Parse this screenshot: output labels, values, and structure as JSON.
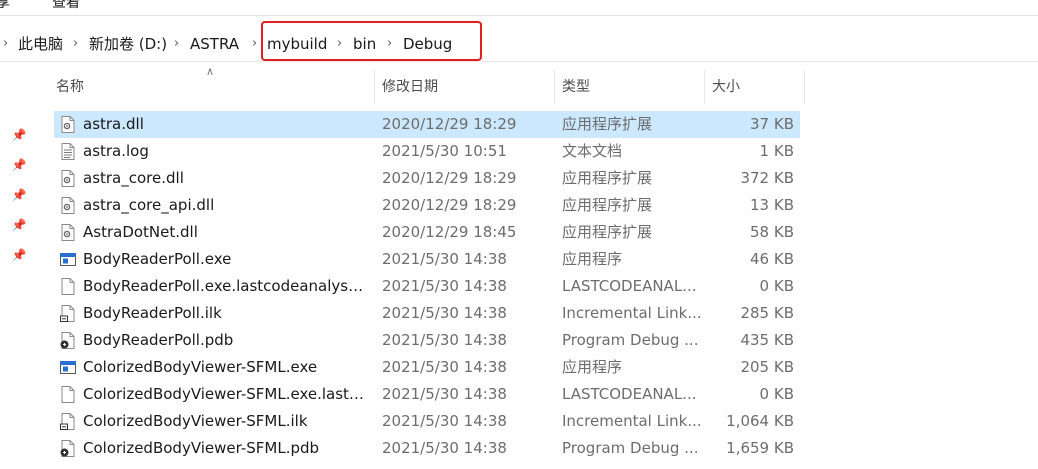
{
  "ribbon": {
    "tabs": [
      "享",
      "查看"
    ]
  },
  "breadcrumb": [
    "此电脑",
    "新加卷 (D:)",
    "ASTRA",
    "mybuild",
    "bin",
    "Debug"
  ],
  "columns": {
    "name": "名称",
    "modified": "修改日期",
    "type": "类型",
    "size": "大小"
  },
  "files": [
    {
      "name": "astra.dll",
      "modified": "2020/12/29 18:29",
      "type": "应用程序扩展",
      "size": "37 KB",
      "icon": "dll-file-icon",
      "selected": true
    },
    {
      "name": "astra.log",
      "modified": "2021/5/30 10:51",
      "type": "文本文档",
      "size": "1 KB",
      "icon": "text-file-icon"
    },
    {
      "name": "astra_core.dll",
      "modified": "2020/12/29 18:29",
      "type": "应用程序扩展",
      "size": "372 KB",
      "icon": "dll-file-icon"
    },
    {
      "name": "astra_core_api.dll",
      "modified": "2020/12/29 18:29",
      "type": "应用程序扩展",
      "size": "13 KB",
      "icon": "dll-file-icon"
    },
    {
      "name": "AstraDotNet.dll",
      "modified": "2020/12/29 18:45",
      "type": "应用程序扩展",
      "size": "58 KB",
      "icon": "dll-file-icon"
    },
    {
      "name": "BodyReaderPoll.exe",
      "modified": "2021/5/30 14:38",
      "type": "应用程序",
      "size": "46 KB",
      "icon": "exe-file-icon"
    },
    {
      "name": "BodyReaderPoll.exe.lastcodeanalysis...",
      "modified": "2021/5/30 14:38",
      "type": "LASTCODEANAL...",
      "size": "0 KB",
      "icon": "blank-file-icon"
    },
    {
      "name": "BodyReaderPoll.ilk",
      "modified": "2021/5/30 14:38",
      "type": "Incremental Link...",
      "size": "285 KB",
      "icon": "ilk-file-icon"
    },
    {
      "name": "BodyReaderPoll.pdb",
      "modified": "2021/5/30 14:38",
      "type": "Program Debug ...",
      "size": "435 KB",
      "icon": "pdb-file-icon"
    },
    {
      "name": "ColorizedBodyViewer-SFML.exe",
      "modified": "2021/5/30 14:38",
      "type": "应用程序",
      "size": "205 KB",
      "icon": "exe-file-icon"
    },
    {
      "name": "ColorizedBodyViewer-SFML.exe.lastc...",
      "modified": "2021/5/30 14:38",
      "type": "LASTCODEANAL...",
      "size": "0 KB",
      "icon": "blank-file-icon"
    },
    {
      "name": "ColorizedBodyViewer-SFML.ilk",
      "modified": "2021/5/30 14:38",
      "type": "Incremental Link...",
      "size": "1,064 KB",
      "icon": "ilk-file-icon"
    },
    {
      "name": "ColorizedBodyViewer-SFML.pdb",
      "modified": "2021/5/30 14:38",
      "type": "Program Debug ...",
      "size": "1,659 KB",
      "icon": "pdb-file-icon"
    }
  ],
  "colors": {
    "selection": "#cce8ff",
    "highlight_box": "#e02020",
    "muted_text": "#6d6d6d"
  }
}
